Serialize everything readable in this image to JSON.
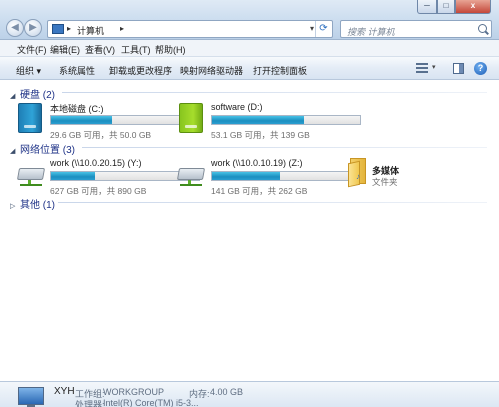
{
  "window": {
    "breadcrumb": "计算机",
    "search_placeholder": "搜索 计算机",
    "controls": {
      "minimize": "─",
      "maximize": "□",
      "close": "x"
    }
  },
  "menu": [
    "文件(F)",
    "编辑(E)",
    "查看(V)",
    "工具(T)",
    "帮助(H)"
  ],
  "commands": {
    "organize": "组织 ▾",
    "system_properties": "系统属性",
    "uninstall": "卸载或更改程序",
    "map_drive": "映射网络驱动器",
    "control_panel": "打开控制面板",
    "help": "?"
  },
  "groups": {
    "hard_disks": {
      "header": "硬盘 (2)",
      "items": [
        {
          "name": "本地磁盘 (C:)",
          "sub": "29.6 GB 可用，共 50.0 GB",
          "used_fraction": 0.41,
          "icon": "hdd-blue-icon"
        },
        {
          "name": "software (D:)",
          "sub": "53.1 GB 可用，共 139 GB",
          "used_fraction": 0.62,
          "icon": "hdd-green-icon"
        }
      ]
    },
    "network": {
      "header": "网络位置 (3)",
      "items": [
        {
          "name": "work (\\\\10.0.20.15) (Y:)",
          "sub": "627 GB 可用，共 890 GB",
          "used_fraction": 0.3,
          "icon": "network-drive-icon"
        },
        {
          "name": "work (\\\\10.0.10.19) (Z:)",
          "sub": "141 GB 可用，共 262 GB",
          "used_fraction": 0.46,
          "icon": "network-drive-icon"
        },
        {
          "name": "多媒体",
          "sub": "文件夹",
          "icon": "folder-icon"
        }
      ]
    },
    "other": {
      "header": "其他 (1)"
    }
  },
  "details": {
    "computer_name": "XYH",
    "workgroup_label": "工作组:",
    "workgroup_value": "WORKGROUP",
    "memory_label": "内存:",
    "memory_value": "4.00 GB",
    "processor_label": "处理器:",
    "processor_value": "Intel(R) Core(TM) i5-3..."
  }
}
